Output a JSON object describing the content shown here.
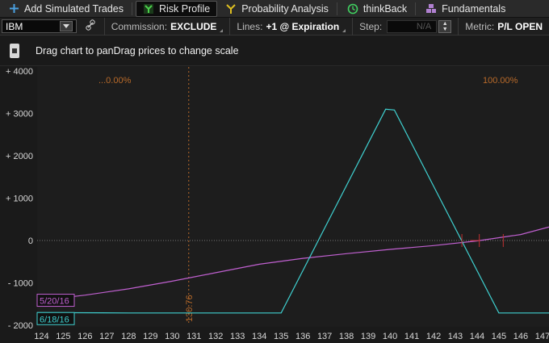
{
  "tabs": [
    {
      "label": "Add Simulated Trades",
      "icon": "plus-icon",
      "active": false
    },
    {
      "label": "Risk Profile",
      "icon": "risk-profile-icon",
      "active": true
    },
    {
      "label": "Probability Analysis",
      "icon": "fork-icon",
      "active": false
    },
    {
      "label": "thinkBack",
      "icon": "clock-icon",
      "active": false
    },
    {
      "label": "Fundamentals",
      "icon": "blocks-icon",
      "active": false
    }
  ],
  "controls": {
    "symbol": "IBM",
    "commission_label": "Commission:",
    "commission_value": "EXCLUDE",
    "lines_label": "Lines:",
    "lines_value": "+1 @ Expiration",
    "step_label": "Step:",
    "step_value": "N/A",
    "metric_label": "Metric:",
    "metric_value": "P/L OPEN"
  },
  "hint": {
    "text": "Drag chart to panDrag prices to change scale"
  },
  "colors": {
    "accent_cyan": "#3fd0d0",
    "accent_magenta": "#c060d0",
    "marker_orange": "#b86a2a",
    "marker_red": "#c03030"
  },
  "chart_data": {
    "type": "line",
    "y_ticks": [
      "+ 4000",
      "+ 3000",
      "+ 2000",
      "+ 1000",
      "0",
      "- 1000",
      "- 2000"
    ],
    "x_ticks": [
      "124",
      "125",
      "126",
      "127",
      "128",
      "129",
      "130",
      "131",
      "132",
      "133",
      "134",
      "135",
      "136",
      "137",
      "138",
      "139",
      "140",
      "141",
      "142",
      "143",
      "144",
      "145",
      "146",
      "147"
    ],
    "xlim": [
      123.8,
      147.3
    ],
    "ylim": [
      -2000,
      4000
    ],
    "annotations": {
      "left_prob": "...0.00%",
      "right_prob": "100.00%",
      "price_marker": "130.76"
    },
    "price_marker_x": 130.76,
    "series": [
      {
        "name": "5/20/16",
        "color": "#c060d0",
        "x": [
          123.8,
          126,
          128,
          130,
          132,
          134,
          136,
          138,
          140,
          142,
          144,
          146,
          147.3
        ],
        "y": [
          -1420,
          -1290,
          -1140,
          -960,
          -760,
          -560,
          -420,
          -310,
          -210,
          -120,
          -10,
          140,
          320
        ]
      },
      {
        "name": "6/18/16",
        "color": "#3fd0d0",
        "x": [
          123.8,
          128,
          135,
          139.8,
          140.2,
          145,
          147.3
        ],
        "y": [
          -1700,
          -1710,
          -1710,
          3100,
          3080,
          -1710,
          -1710
        ]
      }
    ]
  }
}
